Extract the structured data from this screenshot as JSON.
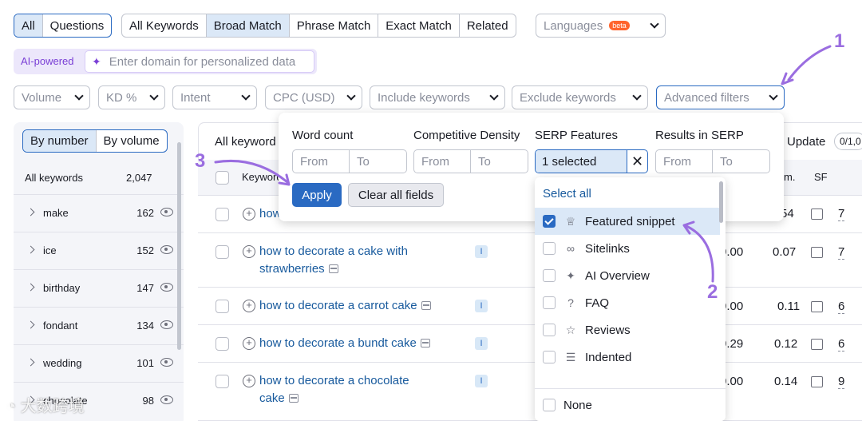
{
  "tabs_left": [
    "All",
    "Questions"
  ],
  "tabs_match": [
    "All Keywords",
    "Broad Match",
    "Phrase Match",
    "Exact Match",
    "Related"
  ],
  "languages": {
    "label": "Languages",
    "badge": "beta"
  },
  "ai": {
    "label": "AI-powered",
    "placeholder": "Enter domain for personalized data"
  },
  "filters": [
    "Volume",
    "KD %",
    "Intent",
    "CPC (USD)",
    "Include keywords",
    "Exclude keywords",
    "Advanced filters"
  ],
  "view_toggle": [
    "By number",
    "By volume"
  ],
  "left_list": {
    "header": {
      "label": "All keywords",
      "count": "2,047"
    },
    "items": [
      {
        "label": "make",
        "count": "162"
      },
      {
        "label": "ice",
        "count": "152"
      },
      {
        "label": "birthday",
        "count": "147"
      },
      {
        "label": "fondant",
        "count": "134"
      },
      {
        "label": "wedding",
        "count": "101"
      },
      {
        "label": "chocolate",
        "count": "98"
      }
    ]
  },
  "table": {
    "title_partial": "All keyword",
    "col_keyword": "Keyword",
    "col_com": "m.",
    "col_sf": "SF",
    "update_label": "Update",
    "update_count": "0/1,0",
    "rows": [
      {
        "kw1": "how",
        "kw2": "",
        "intent": "",
        "cpc": "",
        "com": "54",
        "sf": "7"
      },
      {
        "kw1": "how to decorate a cake with",
        "kw2": "strawberries",
        "intent": "I",
        "cpc": "0.00",
        "com": "0.07",
        "sf": "7"
      },
      {
        "kw1": "how to decorate a carrot cake",
        "kw2": "",
        "intent": "I",
        "cpc": "0.00",
        "com": "0.11",
        "sf": "6"
      },
      {
        "kw1": "how to decorate a bundt cake",
        "kw2": "",
        "intent": "I",
        "cpc": "0.29",
        "com": "0.12",
        "sf": "6"
      },
      {
        "kw1": "how to decorate a chocolate",
        "kw2": "cake",
        "intent": "I",
        "cpc": "0.00",
        "com": "0.14",
        "sf": "9"
      }
    ]
  },
  "popup": {
    "word_count": "Word count",
    "comp_density": "Competitive Density",
    "serp_features": "SERP Features",
    "results_in_serp": "Results in SERP",
    "from": "From",
    "to": "To",
    "serp_selected": "1 selected",
    "apply": "Apply",
    "clear": "Clear all fields"
  },
  "serp_list": {
    "select_all": "Select all",
    "options": [
      {
        "label": "Featured snippet",
        "icon": "crown-icon",
        "glyph": "♕",
        "selected": true
      },
      {
        "label": "Sitelinks",
        "icon": "link-icon",
        "glyph": "∞",
        "selected": false
      },
      {
        "label": "AI Overview",
        "icon": "ai-icon",
        "glyph": "✦",
        "selected": false
      },
      {
        "label": "FAQ",
        "icon": "question-icon",
        "glyph": "?",
        "selected": false
      },
      {
        "label": "Reviews",
        "icon": "star-icon",
        "glyph": "☆",
        "selected": false
      },
      {
        "label": "Indented",
        "icon": "indent-icon",
        "glyph": "☰",
        "selected": false
      }
    ],
    "none": "None"
  },
  "annotations": [
    "1",
    "2",
    "3"
  ],
  "watermark": "大数跨境",
  "colors": {
    "accent": "#2a6ac2",
    "annotation": "#9a6de0",
    "ai": "#7a3fd6",
    "beta": "#ff642d"
  }
}
